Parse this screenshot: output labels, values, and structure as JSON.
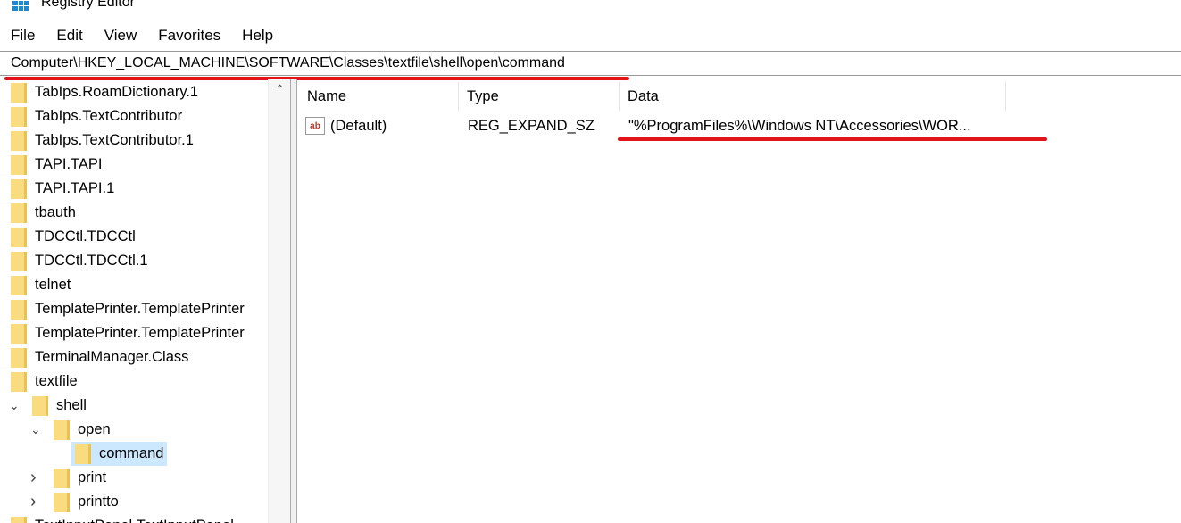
{
  "window": {
    "title": "Registry Editor"
  },
  "menu": [
    "File",
    "Edit",
    "View",
    "Favorites",
    "Help"
  ],
  "address": "Computer\\HKEY_LOCAL_MACHINE\\SOFTWARE\\Classes\\textfile\\shell\\open\\command",
  "tree": [
    {
      "label": "TabIps.RoamDictionary.1",
      "level": 0
    },
    {
      "label": "TabIps.TextContributor",
      "level": 0
    },
    {
      "label": "TabIps.TextContributor.1",
      "level": 0
    },
    {
      "label": "TAPI.TAPI",
      "level": 0
    },
    {
      "label": "TAPI.TAPI.1",
      "level": 0
    },
    {
      "label": "tbauth",
      "level": 0
    },
    {
      "label": "TDCCtl.TDCCtl",
      "level": 0
    },
    {
      "label": "TDCCtl.TDCCtl.1",
      "level": 0
    },
    {
      "label": "telnet",
      "level": 0
    },
    {
      "label": "TemplatePrinter.TemplatePrinter",
      "level": 0
    },
    {
      "label": "TemplatePrinter.TemplatePrinter",
      "level": 0
    },
    {
      "label": "TerminalManager.Class",
      "level": 0
    },
    {
      "label": "textfile",
      "level": 0
    },
    {
      "label": "shell",
      "level": 1,
      "expanded": true
    },
    {
      "label": "open",
      "level": 2,
      "expanded": true
    },
    {
      "label": "command",
      "level": 3,
      "selected": true
    },
    {
      "label": "print",
      "level": 2,
      "collapsed": true
    },
    {
      "label": "printto",
      "level": 2,
      "collapsed": true
    },
    {
      "label": "TextInputPanel.TextInputPanel",
      "level": 0
    }
  ],
  "columns": {
    "name": "Name",
    "type": "Type",
    "data": "Data"
  },
  "values": [
    {
      "name": "(Default)",
      "type": "REG_EXPAND_SZ",
      "data": "\"%ProgramFiles%\\Windows NT\\Accessories\\WOR..."
    }
  ],
  "colors": {
    "highlight": "#e2141a",
    "selection": "#cce8ff"
  }
}
